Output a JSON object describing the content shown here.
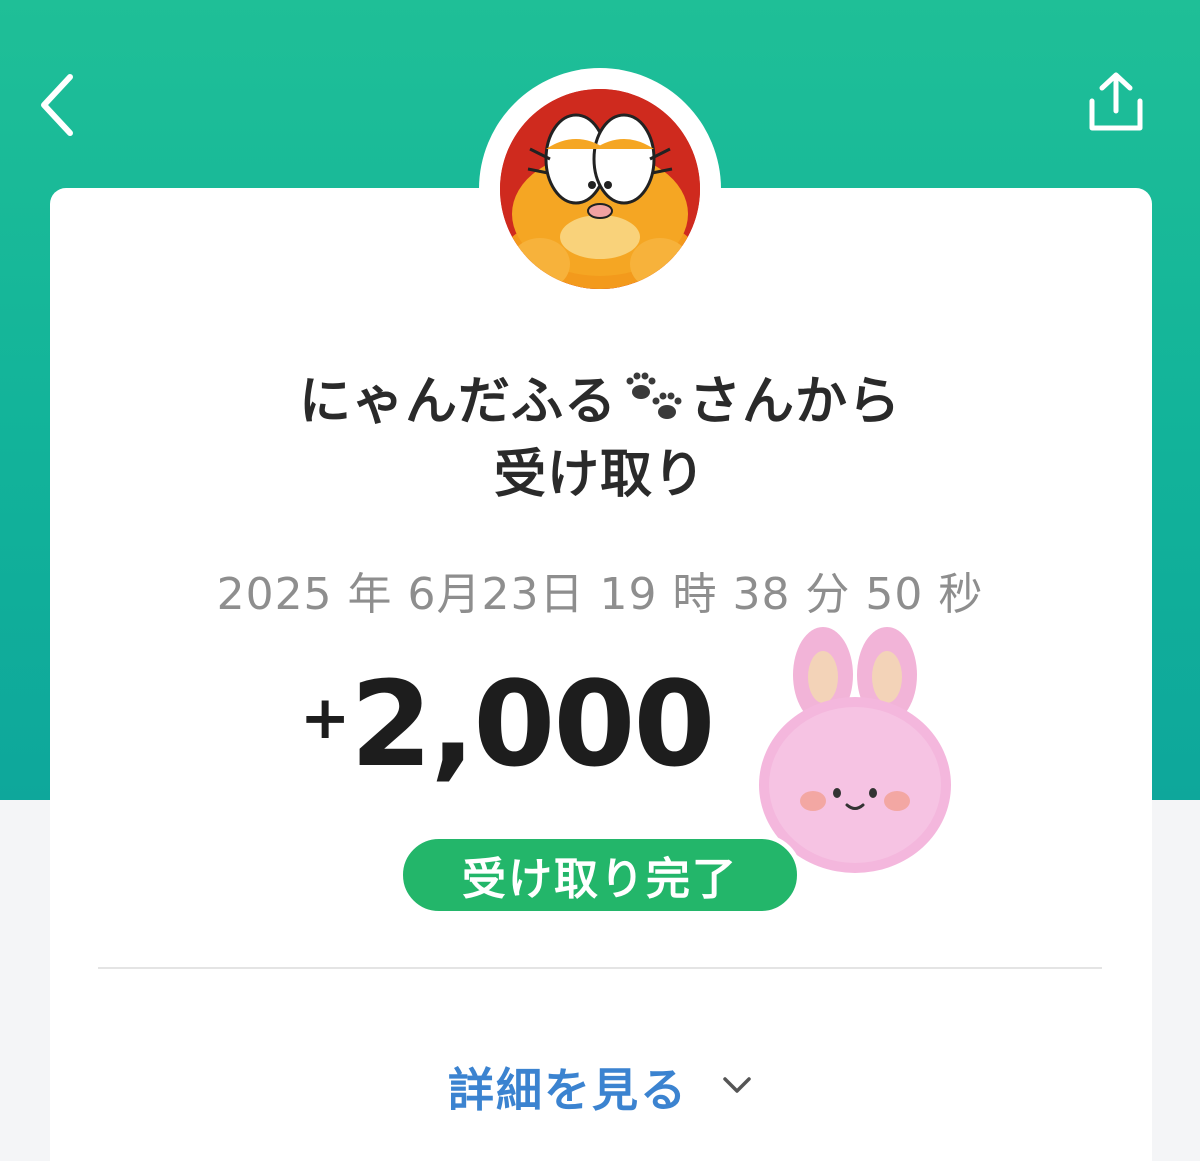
{
  "header": {
    "back_icon": "chevron-left-icon",
    "share_icon": "share-upload-icon",
    "background_colors": [
      "#1fbf97",
      "#0ea79b"
    ]
  },
  "sender": {
    "avatar_icon": "cat-avatar",
    "name_prefix": "にゃんだふる",
    "name_emoji": "paw-prints-icon",
    "name_suffix": "さんから",
    "title_line2": "受け取り"
  },
  "transaction": {
    "datetime": "2025 年 6月23日 19 時 38 分 50 秒",
    "amount_sign": "+",
    "amount": "2,000",
    "status": "受け取り完了",
    "status_color": "#23b66a"
  },
  "sticker": {
    "icon": "pink-bunny-sticker"
  },
  "details": {
    "label": "詳細を見る",
    "icon": "chevron-down-icon",
    "color": "#3b83d0"
  }
}
